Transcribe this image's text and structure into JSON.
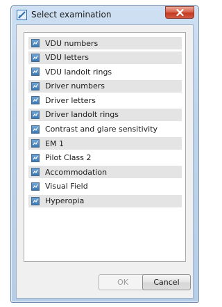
{
  "window": {
    "title": "Select examination"
  },
  "examinations": [
    {
      "label": "VDU numbers",
      "shaded": true
    },
    {
      "label": "VDU letters",
      "shaded": true
    },
    {
      "label": "VDU landolt rings",
      "shaded": false
    },
    {
      "label": "Driver numbers",
      "shaded": true
    },
    {
      "label": "Driver letters",
      "shaded": false
    },
    {
      "label": "Driver landolt rings",
      "shaded": true
    },
    {
      "label": "Contrast and glare sensitivity",
      "shaded": false
    },
    {
      "label": "EM 1",
      "shaded": true
    },
    {
      "label": "Pilot Class 2",
      "shaded": false
    },
    {
      "label": "Accommodation",
      "shaded": true
    },
    {
      "label": "Visual Field",
      "shaded": false
    },
    {
      "label": "Hyperopia",
      "shaded": true
    }
  ],
  "buttons": {
    "ok_label": "OK",
    "ok_enabled": false,
    "cancel_label": "Cancel"
  },
  "icons": {
    "app": "checkmark-app-icon",
    "close": "close-icon",
    "item": "examination-item-icon"
  },
  "colors": {
    "close_button": "#c4371f",
    "titlebar": "#bcd3ec",
    "item_icon": "#3b78b3"
  }
}
